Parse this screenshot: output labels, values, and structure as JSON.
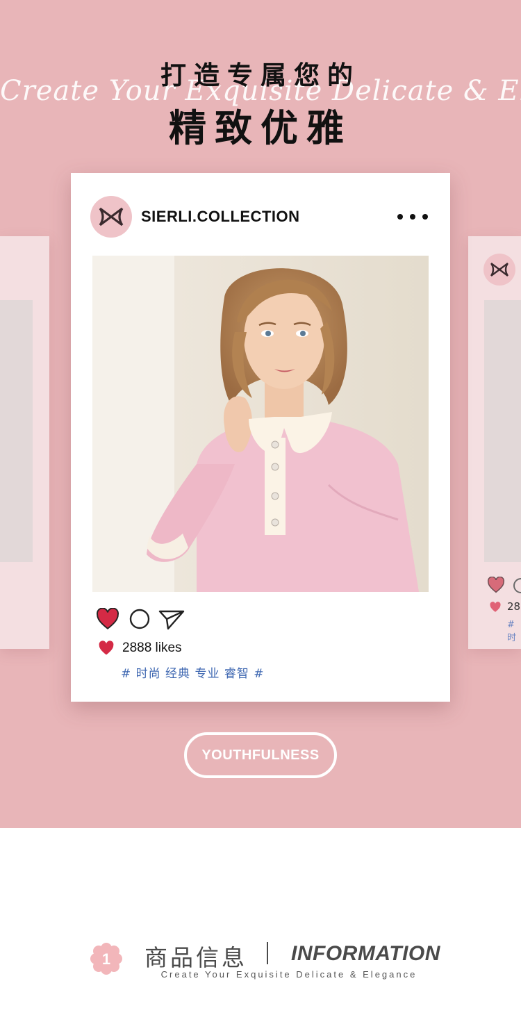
{
  "header": {
    "title_line1": "打造专属您的",
    "title_line2": "精致优雅",
    "script_text": "Create Your Exquisite Delicate & Elegance"
  },
  "post": {
    "username": "SIERLI.COLLECTION",
    "likes": "2888 likes",
    "tags": "# 时尚 经典 专业 睿智 #"
  },
  "side_post": {
    "likes_partial": "28",
    "tags_partial": "# 时"
  },
  "badge": {
    "label": "YOUTHFULNESS"
  },
  "info": {
    "number": "1",
    "title_cn": "商品信息",
    "title_en": "INFORMATION",
    "subtitle": "Create Your Exquisite Delicate & Elegance"
  },
  "colors": {
    "background_pink": "#e8b5b8",
    "heart_red": "#d42a45",
    "tag_blue": "#3e67b1",
    "flower_pink": "#f2b6ba"
  },
  "icons": [
    "brand-logo-icon",
    "more-icon",
    "heart-icon",
    "comment-icon",
    "share-icon",
    "flower-icon"
  ]
}
